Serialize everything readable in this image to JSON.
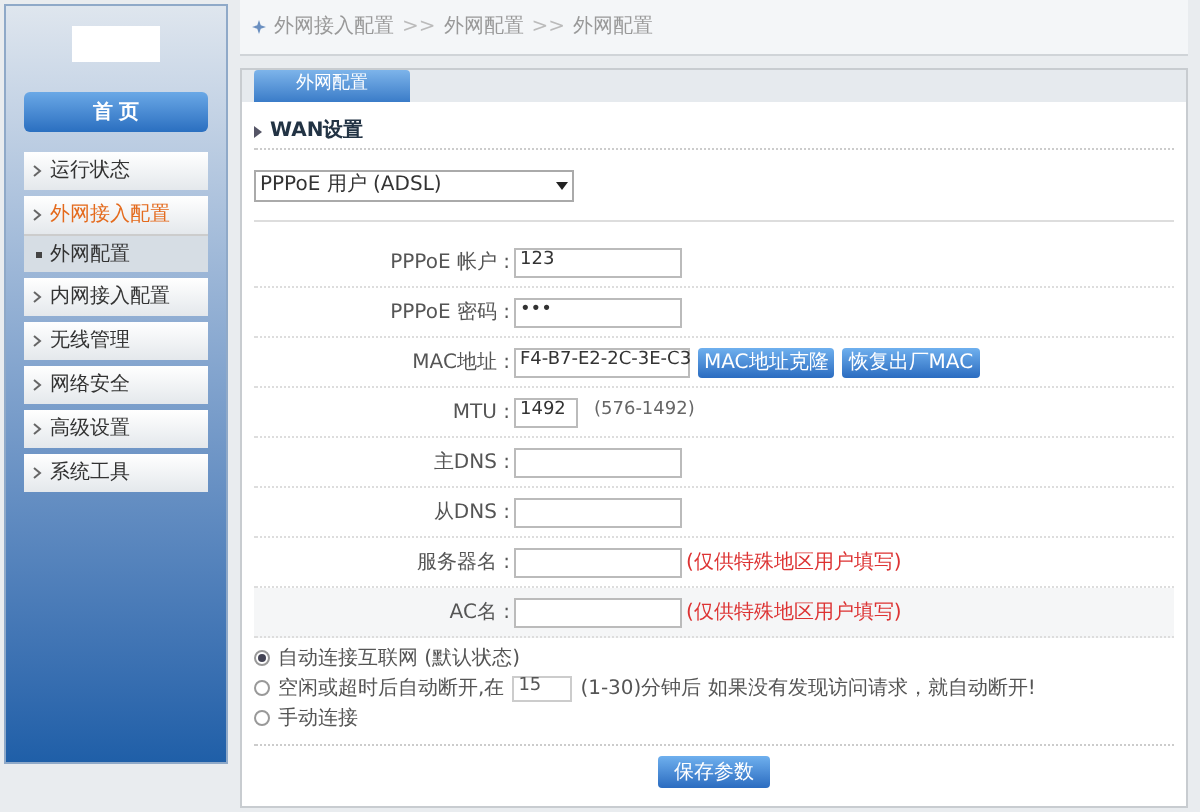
{
  "breadcrumb": [
    {
      "kind": "crumb",
      "text": "外网接入配置"
    },
    {
      "kind": "separator",
      "text": ">>"
    },
    {
      "kind": "crumb",
      "text": "外网配置"
    },
    {
      "kind": "separator",
      "text": ">>"
    },
    {
      "kind": "crumb",
      "text": "外网配置"
    }
  ],
  "sidebar": {
    "home": "首 页",
    "items": [
      {
        "label": "运行状态",
        "selected": false
      },
      {
        "label": "外网接入配置",
        "selected": true,
        "children": [
          {
            "label": "外网配置",
            "selected": true
          }
        ]
      },
      {
        "label": "内网接入配置",
        "selected": false
      },
      {
        "label": "无线管理",
        "selected": false
      },
      {
        "label": "网络安全",
        "selected": false
      },
      {
        "label": "高级设置",
        "selected": false
      },
      {
        "label": "系统工具",
        "selected": false
      }
    ]
  },
  "tabs": [
    {
      "label": "外网配置",
      "selected": true
    }
  ],
  "section_title": "WAN设置",
  "connection_type": "PPPoE 用户 (ADSL)",
  "fields": [
    {
      "kind": "text",
      "label": "PPPoE 帐户 :",
      "value": "123"
    },
    {
      "kind": "text",
      "label": "PPPoE 密码 :",
      "value": "•••"
    },
    {
      "kind": "mac",
      "label": "MAC地址 :",
      "value": "F4-B7-E2-2C-3E-C3",
      "buttons": [
        "MAC地址克隆",
        "恢复出厂MAC"
      ]
    },
    {
      "kind": "text",
      "label": "MTU :",
      "value": "1492",
      "hint": "(576-1492)"
    },
    {
      "kind": "text",
      "label": "主DNS :"
    },
    {
      "kind": "text",
      "label": "从DNS :"
    },
    {
      "kind": "text",
      "label": "服务器名 :",
      "note": "(仅供特殊地区用户填写)"
    },
    {
      "kind": "text",
      "label": "AC名 :",
      "note": "(仅供特殊地区用户填写)"
    }
  ],
  "connect_modes": [
    {
      "kind": "plain",
      "label": "自动连接互联网 (默认状态)",
      "selected": true
    },
    {
      "kind": "timeout",
      "label": "空闲或超时后自动断开,在",
      "value": "15",
      "after": "(1-30)分钟后 如果没有发现访问请求，就自动断开!",
      "selected": false
    },
    {
      "kind": "plain",
      "label": "手动连接",
      "selected": false
    }
  ],
  "save_button": "保存参数"
}
